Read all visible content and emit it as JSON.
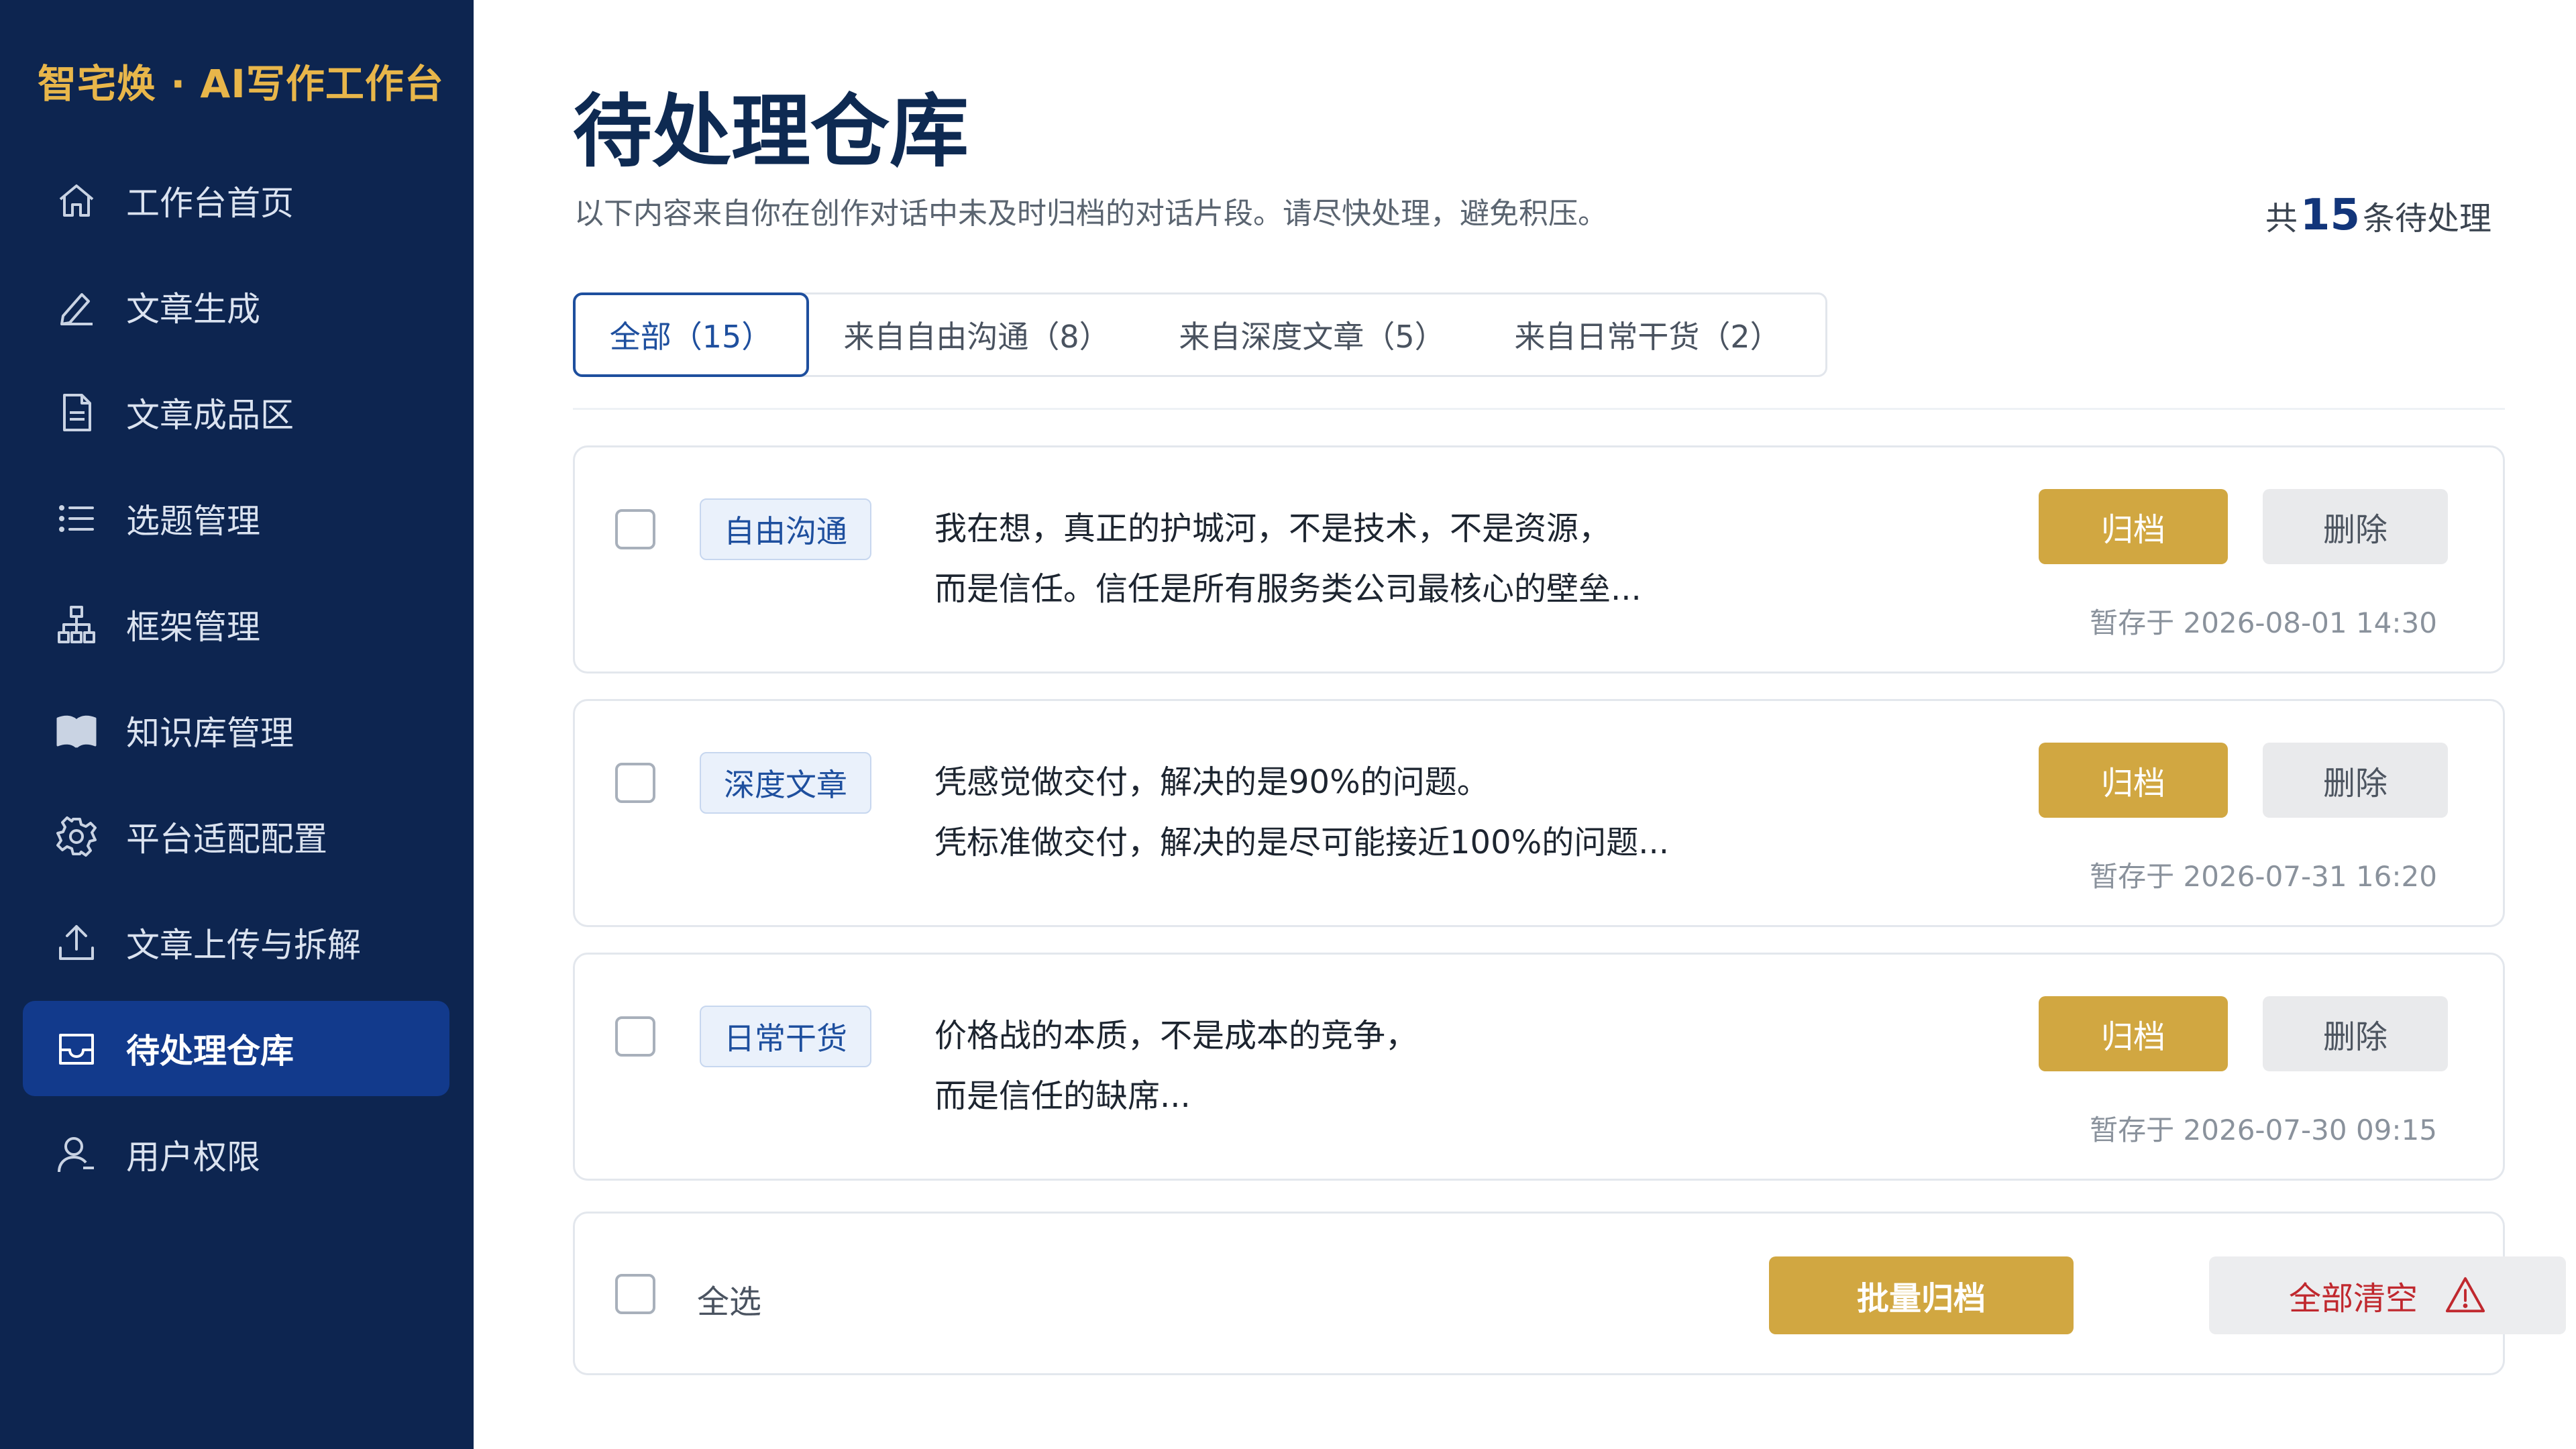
{
  "brand": "智宅焕 · AI写作工作台",
  "sidebar": {
    "items": [
      {
        "label": "工作台首页",
        "icon": "home-icon"
      },
      {
        "label": "文章生成",
        "icon": "pen-icon"
      },
      {
        "label": "文章成品区",
        "icon": "document-icon"
      },
      {
        "label": "选题管理",
        "icon": "list-icon"
      },
      {
        "label": "框架管理",
        "icon": "hierarchy-icon"
      },
      {
        "label": "知识库管理",
        "icon": "book-icon"
      },
      {
        "label": "平台适配配置",
        "icon": "gear-icon"
      },
      {
        "label": "文章上传与拆解",
        "icon": "upload-icon"
      },
      {
        "label": "待处理仓库",
        "icon": "inbox-icon",
        "active": true
      },
      {
        "label": "用户权限",
        "icon": "user-icon"
      }
    ]
  },
  "header": {
    "title": "待处理仓库",
    "description": "以下内容来自你在创作对话中未及时归档的对话片段。请尽快处理，避免积压。",
    "total_prefix": "共",
    "total_count": "15",
    "total_suffix": "条待处理"
  },
  "tabs": [
    {
      "label": "全部（15）",
      "active": true
    },
    {
      "label": "来自自由沟通（8）"
    },
    {
      "label": "来自深度文章（5）"
    },
    {
      "label": "来自日常干货（2）"
    }
  ],
  "items": [
    {
      "tag": "自由沟通",
      "line1": "我在想，真正的护城河，不是技术，不是资源，",
      "line2": "而是信任。信任是所有服务类公司最核心的壁垒...",
      "archive_label": "归档",
      "delete_label": "删除",
      "saved_at": "暂存于 2026-08-01 14:30"
    },
    {
      "tag": "深度文章",
      "line1": "凭感觉做交付，解决的是90%的问题。",
      "line2": "凭标准做交付，解决的是尽可能接近100%的问题...",
      "archive_label": "归档",
      "delete_label": "删除",
      "saved_at": "暂存于 2026-07-31 16:20"
    },
    {
      "tag": "日常干货",
      "line1": "价格战的本质，不是成本的竞争，",
      "line2": "而是信任的缺席...",
      "archive_label": "归档",
      "delete_label": "删除",
      "saved_at": "暂存于 2026-07-30 09:15"
    }
  ],
  "footer": {
    "select_all": "全选",
    "batch_archive": "批量归档",
    "clear_all": "全部清空",
    "clear_icon": "warning-icon"
  },
  "colors": {
    "sidebar_bg": "#0d2550",
    "brand_gold": "#e8b64a",
    "accent_gold": "#d1a741",
    "primary_blue": "#1e4f9e",
    "danger_red": "#c0282e"
  }
}
